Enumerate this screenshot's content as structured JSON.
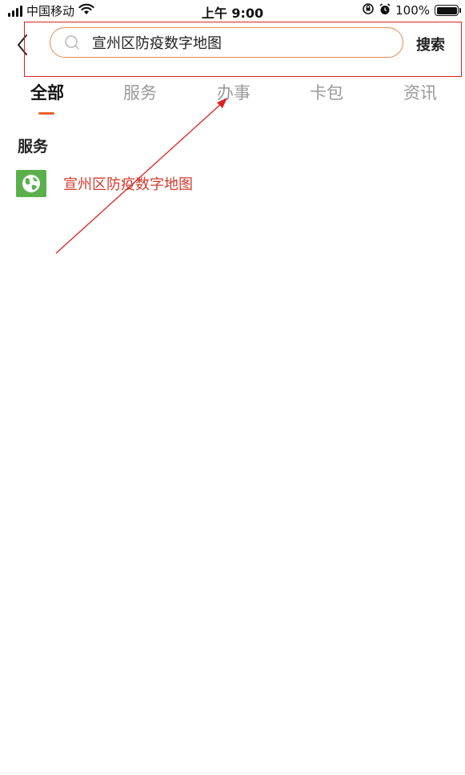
{
  "status_bar": {
    "carrier": "中国移动",
    "time": "上午 9:00",
    "battery": "100%",
    "icons": [
      "signal-icon",
      "wifi-icon",
      "orientation-lock-icon",
      "alarm-icon",
      "battery-icon"
    ]
  },
  "header": {
    "back_icon": "chevron-left-icon",
    "search": {
      "value": "宣州区防疫数字地图",
      "icon": "search-icon"
    },
    "search_button_label": "搜索"
  },
  "tabs": [
    {
      "label": "全部",
      "active": true
    },
    {
      "label": "服务",
      "active": false
    },
    {
      "label": "办事",
      "active": false
    },
    {
      "label": "卡包",
      "active": false
    },
    {
      "label": "资讯",
      "active": false
    }
  ],
  "results": {
    "section_title": "服务",
    "items": [
      {
        "label": "宣州区防疫数字地图",
        "icon": "globe-icon"
      }
    ]
  },
  "colors": {
    "accent": "#e8622a",
    "search_border": "#e58a52",
    "result_text": "#d33a2c",
    "annotation": "#e02020",
    "service_icon_bg": "#5cb04c"
  }
}
